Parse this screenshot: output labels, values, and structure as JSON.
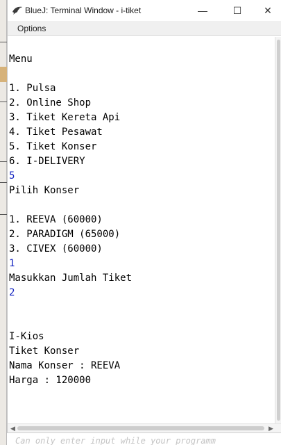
{
  "window": {
    "title": "BlueJ: Terminal Window - i-tiket",
    "minimize_glyph": "—",
    "maximize_glyph": "☐",
    "close_glyph": "✕"
  },
  "menubar": {
    "options_label": "Options"
  },
  "terminal": {
    "lines": [
      {
        "text": "",
        "kind": "output"
      },
      {
        "text": "Menu",
        "kind": "output"
      },
      {
        "text": "",
        "kind": "output"
      },
      {
        "text": "1. Pulsa",
        "kind": "output"
      },
      {
        "text": "2. Online Shop",
        "kind": "output"
      },
      {
        "text": "3. Tiket Kereta Api",
        "kind": "output"
      },
      {
        "text": "4. Tiket Pesawat",
        "kind": "output"
      },
      {
        "text": "5. Tiket Konser",
        "kind": "output"
      },
      {
        "text": "6. I-DELIVERY",
        "kind": "output"
      },
      {
        "text": "5",
        "kind": "input"
      },
      {
        "text": "Pilih Konser",
        "kind": "output"
      },
      {
        "text": "",
        "kind": "output"
      },
      {
        "text": "1. REEVA (60000)",
        "kind": "output"
      },
      {
        "text": "2. PARADIGM (65000)",
        "kind": "output"
      },
      {
        "text": "3. CIVEX (60000)",
        "kind": "output"
      },
      {
        "text": "1",
        "kind": "input"
      },
      {
        "text": "Masukkan Jumlah Tiket",
        "kind": "output"
      },
      {
        "text": "2",
        "kind": "input"
      },
      {
        "text": "",
        "kind": "output"
      },
      {
        "text": "",
        "kind": "output"
      },
      {
        "text": "I-Kios",
        "kind": "output"
      },
      {
        "text": "Tiket Konser",
        "kind": "output"
      },
      {
        "text": "Nama Konser : REEVA",
        "kind": "output"
      },
      {
        "text": "Harga : 120000",
        "kind": "output"
      }
    ]
  },
  "statusbar": {
    "text": "Can only enter input while your programm"
  },
  "colors": {
    "input_text": "#1020c0",
    "output_text": "#000000"
  },
  "icons": {
    "app": "bluej-bird-icon",
    "scroll_left": "chevron-left-icon",
    "scroll_right": "chevron-right-icon"
  }
}
